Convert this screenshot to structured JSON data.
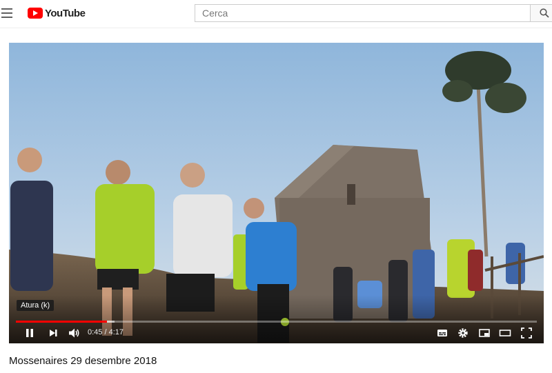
{
  "header": {
    "logo_text": "YouTube",
    "search_placeholder": "Cerca"
  },
  "player": {
    "tooltip": "Atura (k)",
    "time_display": "0:45 / 4:17",
    "progress_played": 0.175,
    "progress_loaded": 0.19,
    "colors": {
      "played": "#ff0000",
      "track": "#ffffff"
    }
  },
  "video": {
    "title": "Mossenaires 29 desembre 2018"
  },
  "icons": [
    "menu-icon",
    "youtube-logo-icon",
    "search-icon",
    "pause-icon",
    "next-icon",
    "volume-icon",
    "subtitles-icon",
    "settings-gear-icon",
    "miniplayer-icon",
    "theater-mode-icon",
    "fullscreen-icon"
  ]
}
